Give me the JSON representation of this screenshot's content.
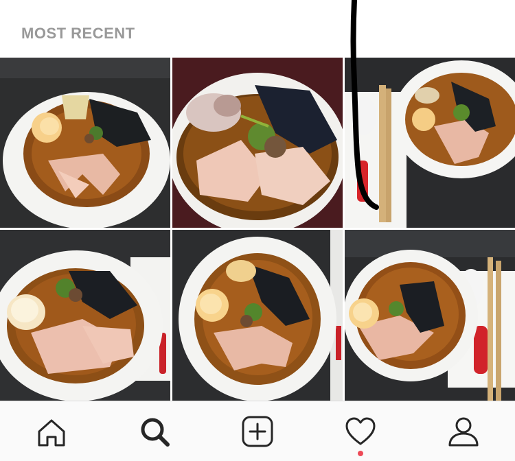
{
  "section": {
    "title": "MOST RECENT"
  },
  "posts": [
    {
      "icon": "ramen-photo",
      "description_hidden": true
    },
    {
      "icon": "ramen-photo",
      "description_hidden": true
    },
    {
      "icon": "ramen-photo",
      "description_hidden": true
    },
    {
      "icon": "ramen-photo",
      "description_hidden": true
    },
    {
      "icon": "ramen-photo",
      "description_hidden": true
    },
    {
      "icon": "ramen-photo",
      "description_hidden": true
    }
  ],
  "tabbar": {
    "items": [
      {
        "icon": "home-icon",
        "active": false
      },
      {
        "icon": "search-icon",
        "active": true
      },
      {
        "icon": "add-post-icon",
        "active": false
      },
      {
        "icon": "heart-icon",
        "active": false,
        "has_notification": true
      },
      {
        "icon": "profile-icon",
        "active": false
      }
    ]
  },
  "colors": {
    "header_text": "#999999",
    "tabbar_bg": "#fafafa",
    "notification": "#ed4956",
    "icon": "#262626"
  }
}
